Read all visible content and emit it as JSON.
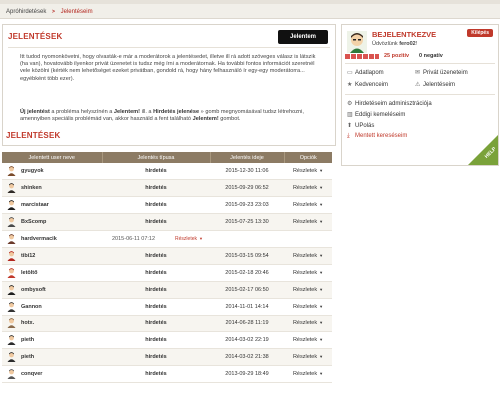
{
  "breadcrumb": {
    "items": [
      "Apróhirdetések",
      "Jelentéseim"
    ],
    "separator": ">"
  },
  "info": {
    "title": "JELENTÉSEK",
    "report_button": "Jelentem",
    "p1": "Itt tudod nyomonkövetni, hogy olvasták-e már a moderátorok a jelentésedet, illetve ill rá adott szöveges válasz is látszik (ha van), hovatovább ilyenkor privát üzenetet is tudsz még írni a moderátornak. Ha további fontos információt szeretnél vele közölni (kérték nem lehetőséget ezeket privátban, gondold rá, hogy hány felhasználó ír egy-egy moderátorra... egyébként több ezer).",
    "p2_b1": "Új jelentést",
    "p2_t1": " a probléma helyszínén a ",
    "p2_b2": "Jelentem!",
    "p2_t2": " ill. a ",
    "p2_b3": "Hirdetés jelenése",
    "p2_t3": " » gomb megnyomásával tudsz létrehozni, amennyiben speciális problémád van, akkor használd a fent található ",
    "p2_b4": "Jelentem!",
    "p2_t4": " gombot."
  },
  "list": {
    "title": "JELENTÉSEK",
    "columns": [
      "Jelentett user neve",
      "Jelentés típusa",
      "Jelentés ideje",
      "Opciók"
    ],
    "rows": [
      {
        "user": "gyugyok",
        "type": "hirdetés",
        "date": "2015-12-30 11:06",
        "opt": "Részletek",
        "av": "#7a4a2a"
      },
      {
        "user": "shinken",
        "type": "hirdetés",
        "date": "2015-09-29 06:52",
        "opt": "Részletek",
        "av": "#2f2a26"
      },
      {
        "user": "marcistaar",
        "type": "hirdetés",
        "date": "2015-09-23 23:03",
        "opt": "Részletek",
        "av": "#1f1f1f"
      },
      {
        "user": "BxScomp",
        "type": "hirdetés",
        "date": "2015-07-25 13:30",
        "opt": "Részletek",
        "av": "#4a4a4a"
      },
      {
        "user": "hardvermacik",
        "type": "",
        "date": "2015-06-11 07:12",
        "opt": "Részletek",
        "av": "#6b3a2a",
        "inline": true
      },
      {
        "user": "tibi12",
        "type": "hirdetés",
        "date": "2015-03-15 09:54",
        "opt": "Részletek",
        "av": "#b3261e"
      },
      {
        "user": "letöltő",
        "type": "hirdetés",
        "date": "2015-02-18 20:46",
        "opt": "Részletek",
        "av": "#c0392b"
      },
      {
        "user": "ombysoft",
        "type": "hirdetés",
        "date": "2015-02-17 06:50",
        "opt": "Részletek",
        "av": "#1f1f1f"
      },
      {
        "user": "Gannon",
        "type": "hirdetés",
        "date": "2014-11-01 14:14",
        "opt": "Részletek",
        "av": "#333333"
      },
      {
        "user": "hotx.",
        "type": "hirdetés",
        "date": "2014-06-28 11:19",
        "opt": "Részletek",
        "av": "#8a6a4a"
      },
      {
        "user": "pieth",
        "type": "hirdetés",
        "date": "2014-03-02 22:19",
        "opt": "Részletek",
        "av": "#2c2c2c"
      },
      {
        "user": "pieth",
        "type": "hirdetés",
        "date": "2014-03-02 21:38",
        "opt": "Részletek",
        "av": "#2c2c2c"
      },
      {
        "user": "conqver",
        "type": "hirdetés",
        "date": "2013-09-29 18:49",
        "opt": "Részletek",
        "av": "#555555"
      }
    ]
  },
  "user": {
    "status": "BEJELENTKEZVE",
    "badge": "Kilépés",
    "welcome_prefix": "Üdvözlünk ",
    "name": "fero02",
    "welcome_suffix": "!",
    "positive": "25 pozitív",
    "negative": "0 negatív",
    "links": {
      "ads": "Adatlapom",
      "messages": "Privát üzeneteim",
      "favorites": "Kedvenceim",
      "reports": "Jelentéseim",
      "admin": "Hirdetéseim adminisztrációja",
      "wins": "Eddigi kemeléseim",
      "ups": "UPolás",
      "saved": "Mentett kereséseim"
    },
    "help": "HELP"
  },
  "colors": {
    "accent": "#c0392b",
    "header": "#8c7b64",
    "help": "#7aa23a"
  }
}
